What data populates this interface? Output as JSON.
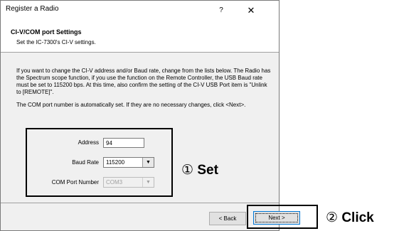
{
  "window": {
    "title": "Register a Radio",
    "help_label": "?",
    "close_label": "✕"
  },
  "header": {
    "title": "CI-V/COM port Settings",
    "subtitle": "Set the IC-7300's CI-V settings."
  },
  "body": {
    "para1": "If you want to change the CI-V address and/or Baud rate, change from the lists below. The Radio has the Spectrum scope function, if you use the function on the Remote Controller, the USB Baud rate must be set to 115200 bps. At this time, also confirm the setting of the CI-V USB Port item is \"Unlink to [REMOTE]\".",
    "para2": "The COM port number is automatically set. If they are no necessary changes, click <Next>."
  },
  "form": {
    "address_label": "Address",
    "address_value": "94",
    "baud_label": "Baud Rate",
    "baud_value": "115200",
    "com_label": "COM Port Number",
    "com_value": "COM3"
  },
  "buttons": {
    "back_label": "< Back",
    "next_label": "Next >"
  },
  "annotations": {
    "set_num": "①",
    "set_text": "Set",
    "click_num": "②",
    "click_text": "Click"
  },
  "icons": {
    "dropdown": "chevron-down-icon"
  }
}
